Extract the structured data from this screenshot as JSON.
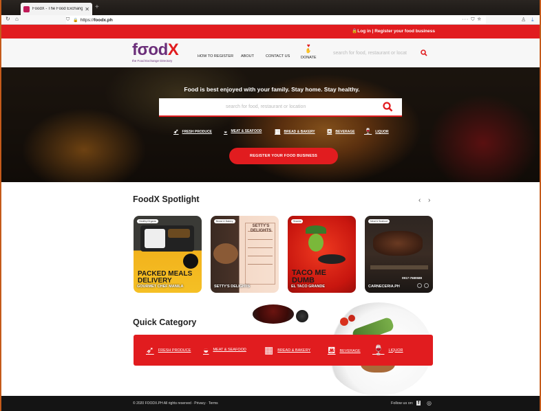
{
  "browser": {
    "tab_title": "FoodX - The Food Exchange Di",
    "tab_close": "✕",
    "new_tab": "+",
    "url_prefix": "https://",
    "url_domain": "foodx.ph",
    "page_actions": "··· ⛉ ☆"
  },
  "topbar": {
    "login_text": "🔒Log in | Register your food business"
  },
  "header": {
    "logo_main": "fσod",
    "logo_x": "X",
    "logo_tagline": "the Food Exchange Directory",
    "nav": [
      {
        "label": "HOW TO REGISTER"
      },
      {
        "label": "ABOUT"
      },
      {
        "label": "CONTACT US"
      },
      {
        "label": "DONATE"
      }
    ],
    "search_placeholder": "search for food, restaurant or locat"
  },
  "hero": {
    "tagline": "Food is best enjoyed with your family. Stay home. Stay healthy.",
    "search_placeholder": "search for food, restaurant or location",
    "categories": [
      {
        "label": "FRESH PRODUCE"
      },
      {
        "label": "MEAT & SEAFOOD"
      },
      {
        "label": "BREAD & BAKERY"
      },
      {
        "label": "BEVERAGE"
      },
      {
        "label": "LIQUOR"
      }
    ],
    "register_label": "REGISTER YOUR FOOD BUSINESS"
  },
  "spotlight": {
    "title": "FoodX Spotlight",
    "prev": "‹",
    "next": "›",
    "cards": [
      {
        "badge": "Healthy/Organic",
        "name": "GOURMET CHEF MANILA",
        "big": "PACKED MEALS DELIVERY"
      },
      {
        "badge": "Bread & Bakery",
        "name": "SETTY'S DELIGHTS",
        "big": "SETTY'S DELIGHTS"
      },
      {
        "badge": "Snacks",
        "name": "EL TACO GRANDE",
        "big": "TACO ME DUMB"
      },
      {
        "badge": "Meat & Seafood",
        "name": "CARNECERIA.PH",
        "big": "0917-7580588"
      }
    ]
  },
  "quick_category": {
    "title": "Quick Category",
    "items": [
      {
        "label": "FRESH PRODUCE"
      },
      {
        "label": "MEAT & SEAFOOD"
      },
      {
        "label": "BREAD & BAKERY"
      },
      {
        "label": "BEVERAGE"
      },
      {
        "label": "LIQUOR"
      }
    ]
  },
  "footer": {
    "copyright": "© 2020 FOODX.PH All rights reserved · Privacy · Terms",
    "follow": "Follow us on:"
  },
  "colors": {
    "brand_red": "#e11c1f",
    "brand_purple": "#6b2f7a"
  }
}
